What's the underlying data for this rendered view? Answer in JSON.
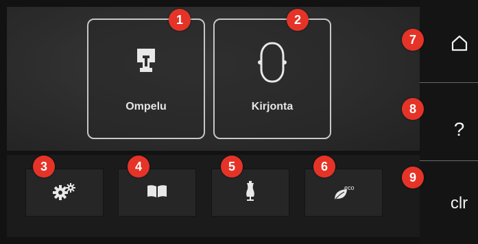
{
  "main": {
    "modes": [
      {
        "label": "Ompelu",
        "icon": "presser-foot-icon",
        "badge": "1"
      },
      {
        "label": "Kirjonta",
        "icon": "embroidery-hoop-icon",
        "badge": "2"
      }
    ]
  },
  "toolbar": {
    "buttons": [
      {
        "icon": "gears-icon",
        "badge": "3"
      },
      {
        "icon": "book-icon",
        "badge": "4"
      },
      {
        "icon": "dress-form-icon",
        "badge": "5"
      },
      {
        "icon": "eco-leaf-icon",
        "text": "eco",
        "badge": "6"
      }
    ]
  },
  "sidebar": {
    "home": {
      "icon": "home-icon",
      "badge": "7"
    },
    "help": {
      "label": "?",
      "badge": "8"
    },
    "clear": {
      "label": "clr",
      "badge": "9"
    }
  },
  "colors": {
    "badge": "#e63328",
    "background": "#121212",
    "panel": "#2c2c2c",
    "button_border": "#c8c8c8"
  }
}
